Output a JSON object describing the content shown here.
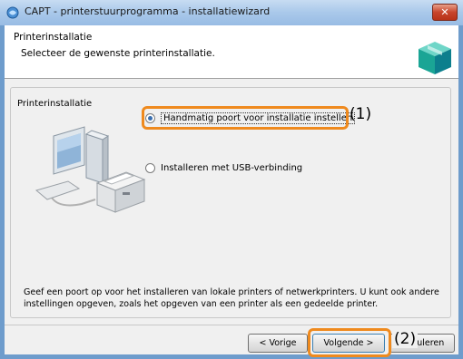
{
  "window": {
    "title": "CAPT - printerstuurprogramma - installatiewizard",
    "close_label": "✕"
  },
  "header": {
    "title": "Printerinstallatie",
    "subtitle": "Selecteer de gewenste printerinstallatie."
  },
  "group": {
    "label": "Printerinstallatie",
    "options": [
      {
        "label": "Handmatig poort voor installatie instellen",
        "selected": true
      },
      {
        "label": "Installeren met USB-verbinding",
        "selected": false
      }
    ],
    "description": "Geef een poort op voor het installeren van lokale printers of netwerkprinters. U kunt ook andere instellingen opgeven, zoals het opgeven van een printer als een gedeelde printer."
  },
  "buttons": {
    "back": "< Vorige",
    "next": "Volgende >",
    "cancel": "Annuleren"
  },
  "callouts": {
    "one": "(1)",
    "two": "(2)"
  },
  "colors": {
    "callout": "#ef8a1e",
    "titlebar": "#a9c8ea"
  },
  "icons": [
    "wizard-app-icon",
    "close-icon",
    "printer-box-icon",
    "computer-printer-illustration"
  ]
}
